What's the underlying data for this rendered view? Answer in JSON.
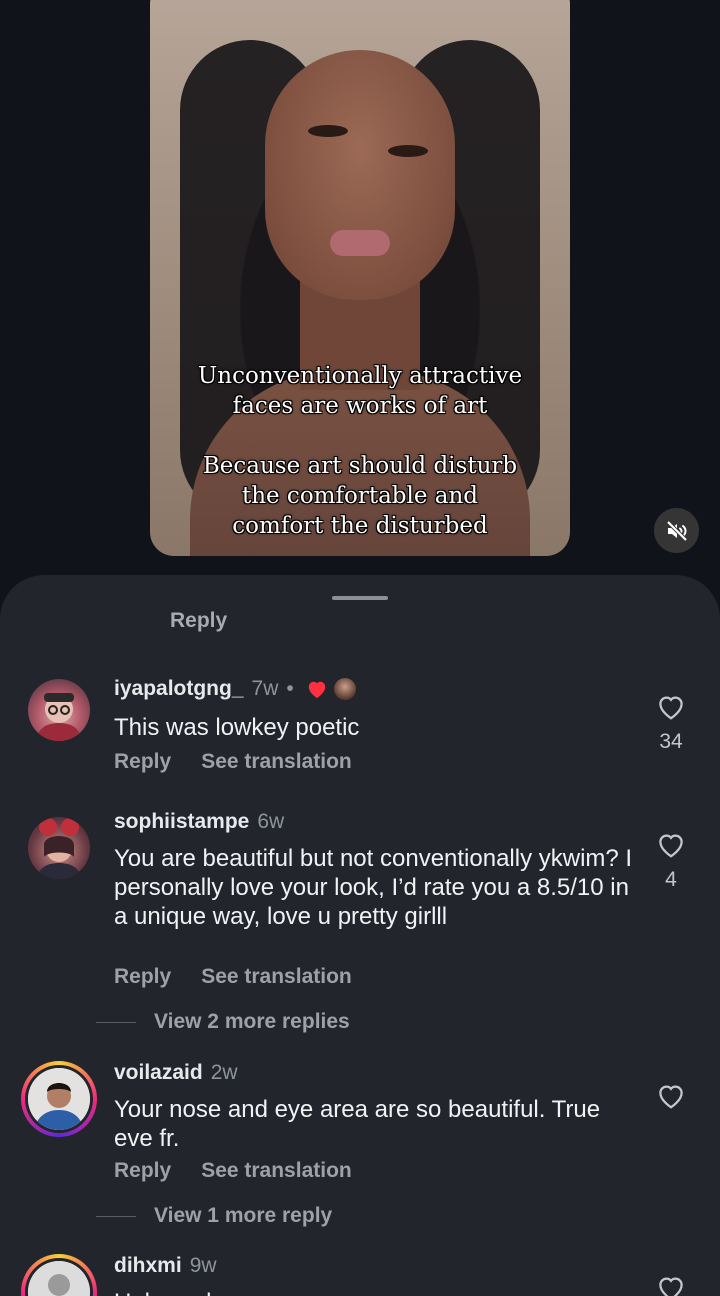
{
  "video": {
    "caption_line1": "Unconventionally attractive",
    "caption_line2": "faces are works of art",
    "caption_line3": "Because art should disturb",
    "caption_line4": "the comfortable and",
    "caption_line5": "comfort the disturbed",
    "mute_icon": "speaker-muted-icon"
  },
  "sheet": {
    "clipped_reply_label": "Reply"
  },
  "comments": [
    {
      "username": "iyapalotgng_",
      "time": "7w",
      "separator": "•",
      "liked_by_creator_icon": "heart-icon",
      "text": "This was lowkey poetic",
      "reply_label": "Reply",
      "translate_label": "See translation",
      "like_count": "34"
    },
    {
      "username": "sophiistampe",
      "time": "6w",
      "text": "You are beautiful but not conventionally ykwim? I personally love your look, I’d rate you a 8.5/10 in a unique way, love u pretty girlll",
      "reply_label": "Reply",
      "translate_label": "See translation",
      "like_count": "4",
      "view_more": "View 2 more replies"
    },
    {
      "username": "voilazaid",
      "time": "2w",
      "text": "Your nose and eye area are so beautiful. True eve fr.",
      "reply_label": "Reply",
      "translate_label": "See translation",
      "like_count": "",
      "view_more": "View 1 more reply"
    },
    {
      "username": "dihxmi",
      "time": "9w",
      "text": "Unbound",
      "like_count": ""
    }
  ],
  "colors": {
    "background": "#10131a",
    "sheet": "#22252c",
    "heart_red": "#ff3040"
  }
}
